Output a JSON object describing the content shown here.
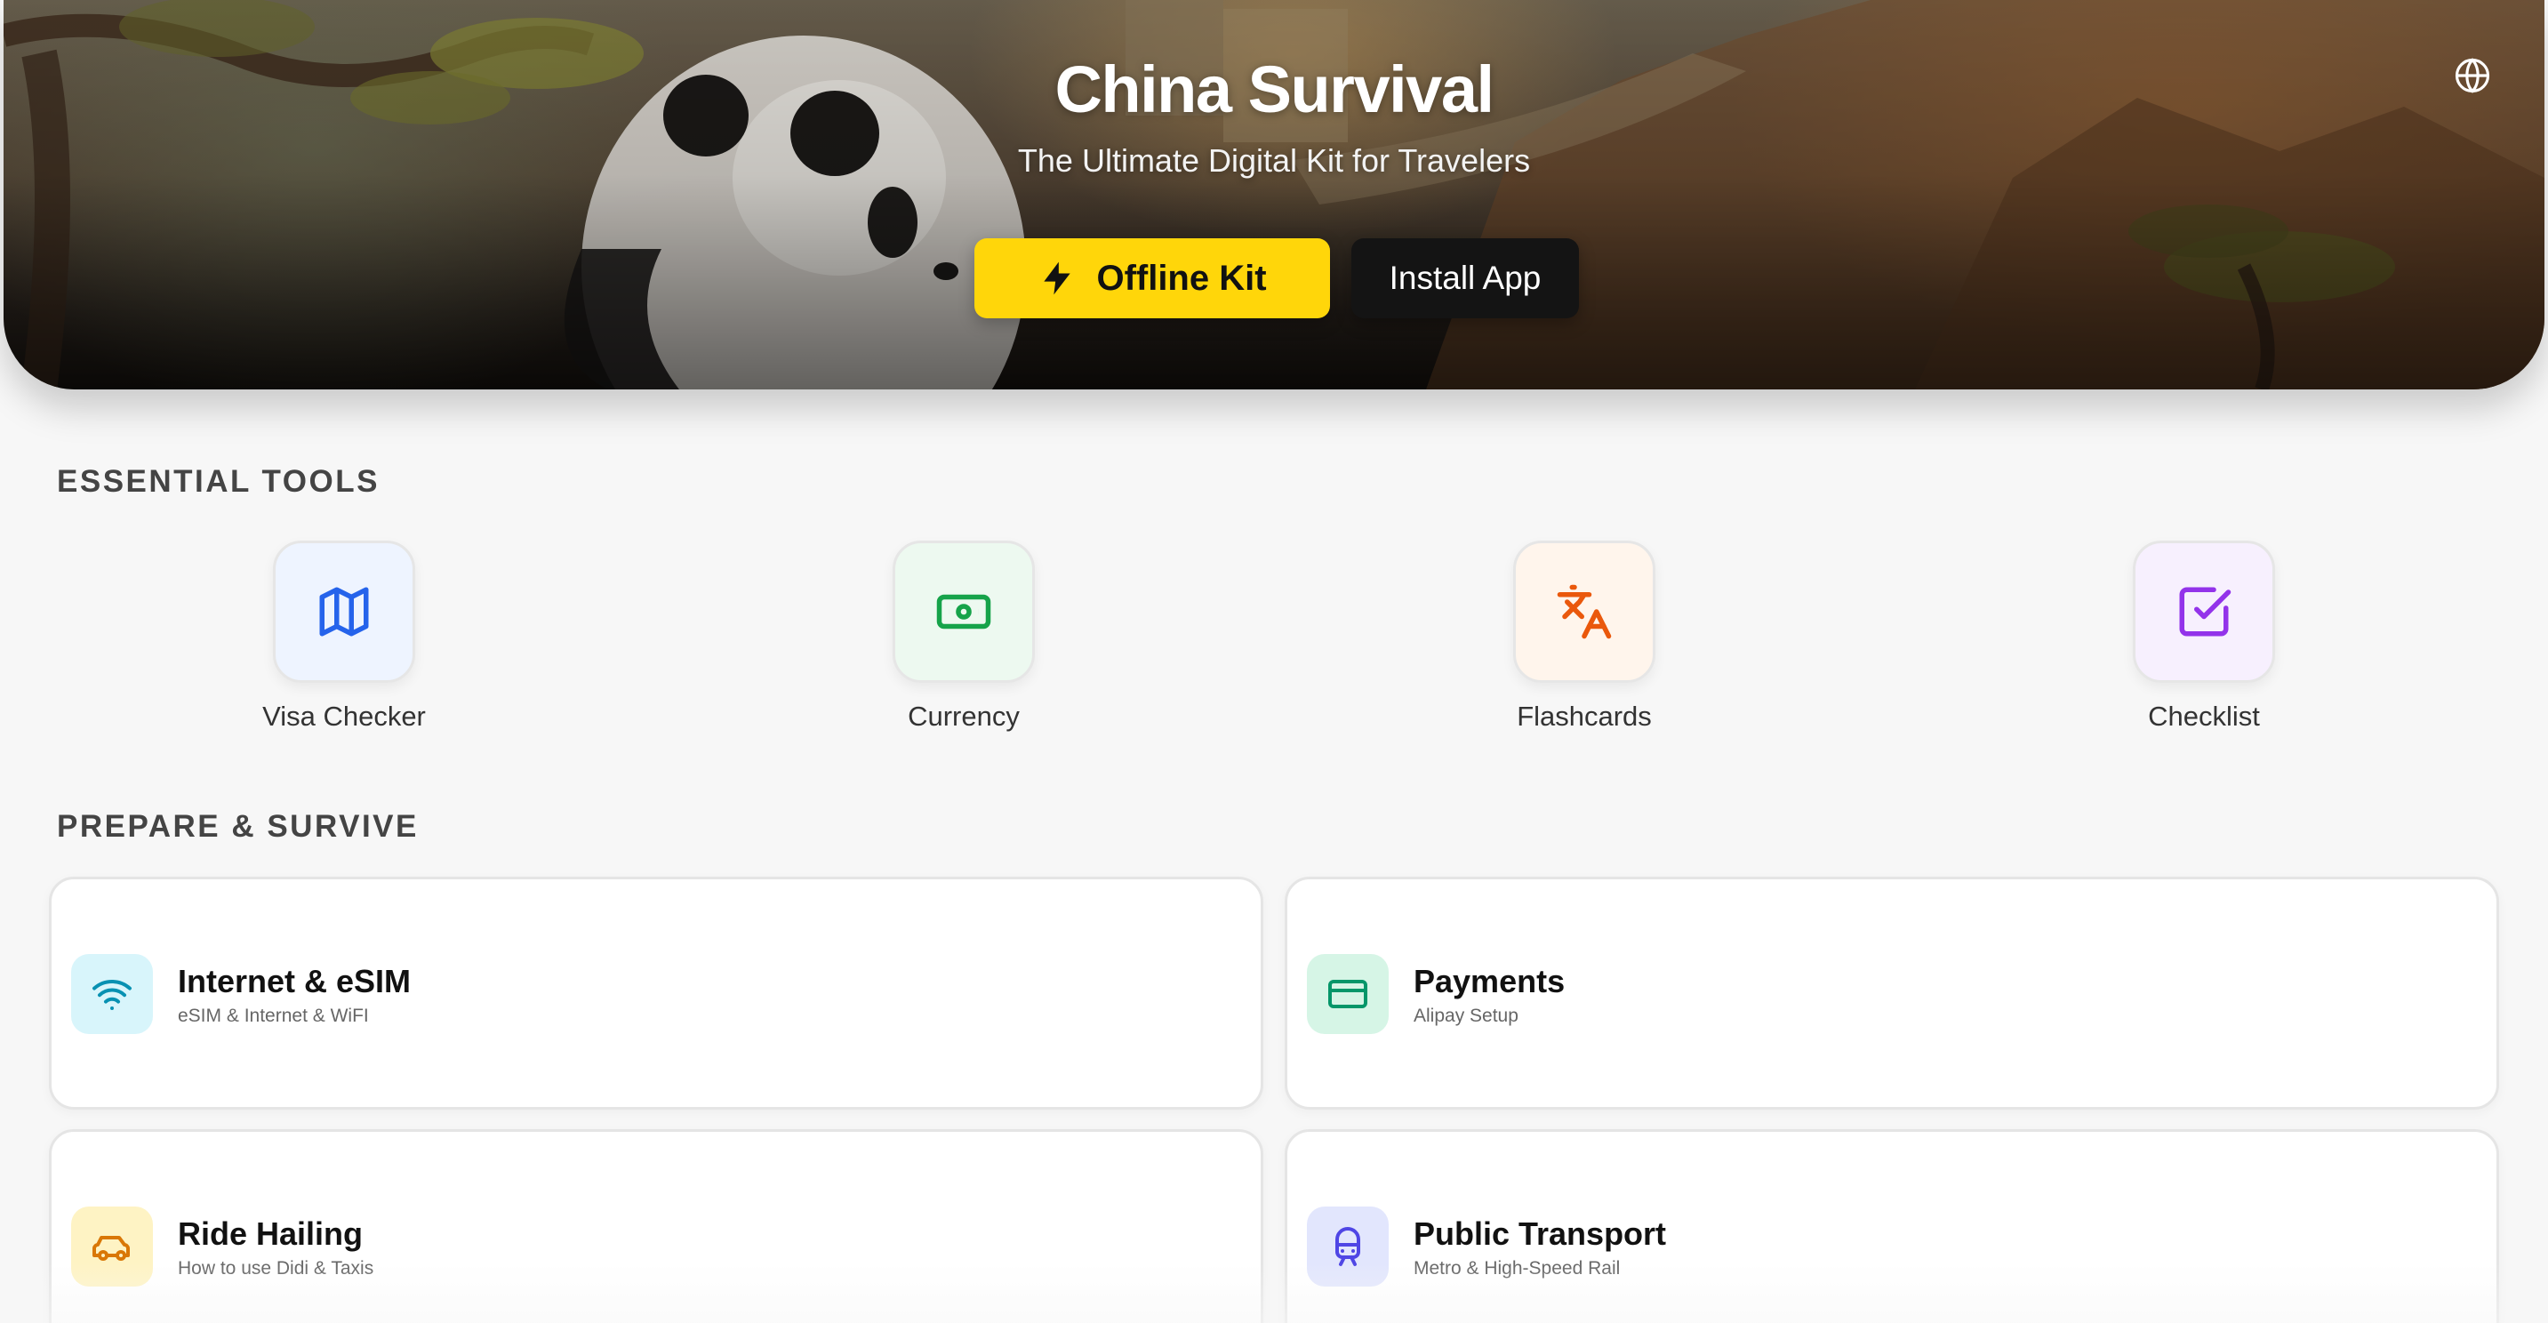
{
  "hero": {
    "title": "China Survival",
    "subtitle": "The Ultimate Digital Kit for Travelers",
    "offline_kit_label": "Offline Kit",
    "install_app_label": "Install App"
  },
  "colors": {
    "accent_yellow": "#ffd60a",
    "install_button": "#141414"
  },
  "essential_tools": {
    "title": "ESSENTIAL TOOLS",
    "items": [
      {
        "label": "Visa Checker",
        "icon": "map-icon",
        "color": "#2563eb",
        "bg": "#eef4ff"
      },
      {
        "label": "Currency",
        "icon": "banknote-icon",
        "color": "#16a34a",
        "bg": "#edf9f0"
      },
      {
        "label": "Flashcards",
        "icon": "translate-icon",
        "color": "#ea580c",
        "bg": "#fff5ec"
      },
      {
        "label": "Checklist",
        "icon": "checkbox-icon",
        "color": "#9333ea",
        "bg": "#f7f0fe"
      }
    ]
  },
  "prepare": {
    "title": "PREPARE & SURVIVE",
    "cards": [
      {
        "title": "Internet & eSIM",
        "subtitle": "eSIM & Internet & WiFI",
        "icon": "wifi-icon",
        "color": "#0891b2",
        "bg": "#d8f5fb"
      },
      {
        "title": "Payments",
        "subtitle": "Alipay Setup",
        "icon": "credit-card-icon",
        "color": "#059669",
        "bg": "#d6f5e6"
      },
      {
        "title": "Ride Hailing",
        "subtitle": "How to use Didi & Taxis",
        "icon": "car-icon",
        "color": "#d97706",
        "bg": "#fef3c4"
      },
      {
        "title": "Public Transport",
        "subtitle": "Metro & High-Speed Rail",
        "icon": "train-icon",
        "color": "#4f46e5",
        "bg": "#e2e6fd"
      }
    ]
  }
}
